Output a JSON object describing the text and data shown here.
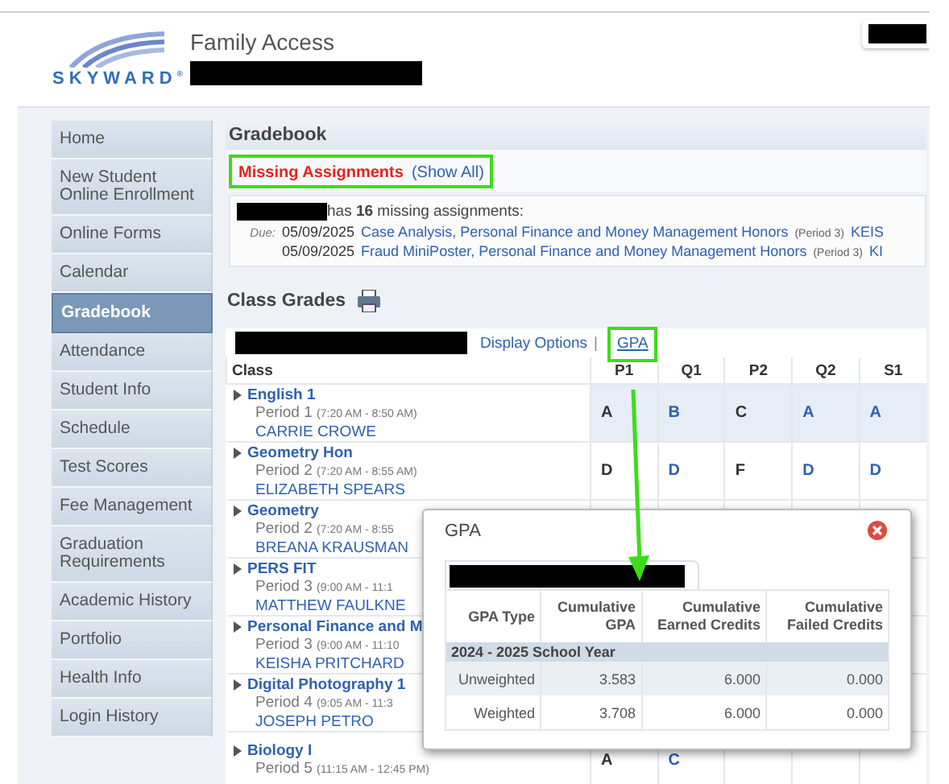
{
  "header": {
    "logo_text": "SKYWARD$^{®}$",
    "app_title": "Family Access"
  },
  "sidebar": {
    "items": [
      {
        "label": "Home",
        "selected": false
      },
      {
        "label": "New Student Online Enrollment",
        "selected": false
      },
      {
        "label": "Online Forms",
        "selected": false
      },
      {
        "label": "Calendar",
        "selected": false
      },
      {
        "label": "Gradebook",
        "selected": true
      },
      {
        "label": "Attendance",
        "selected": false
      },
      {
        "label": "Student Info",
        "selected": false
      },
      {
        "label": "Schedule",
        "selected": false
      },
      {
        "label": "Test Scores",
        "selected": false
      },
      {
        "label": "Fee Management",
        "selected": false
      },
      {
        "label": "Graduation Requirements",
        "selected": false
      },
      {
        "label": "Academic History",
        "selected": false
      },
      {
        "label": "Portfolio",
        "selected": false
      },
      {
        "label": "Health Info",
        "selected": false
      },
      {
        "label": "Login History",
        "selected": false
      }
    ]
  },
  "gradebook": {
    "title": "Gradebook",
    "missing": {
      "heading": "Missing Assignments",
      "show_all": "(Show All)",
      "summary": "has **16** missing assignments:",
      "due_label": "Due:",
      "assignments": [
        {
          "date": "05/09/2025",
          "title": "Case Analysis, Personal Finance and Money Management Honors",
          "period": "(Period 3)",
          "teacher": "KEIS"
        },
        {
          "date": "05/09/2025",
          "title": "Fraud MiniPoster, Personal Finance and Money Management Honors",
          "period": "(Period 3)",
          "teacher": "KI"
        }
      ]
    }
  },
  "class_grades": {
    "title": "Class Grades",
    "display_options": "Display Options",
    "separator": "|",
    "gpa_link": "GPA",
    "columns": [
      {
        "label": "Class",
        "kind": "class"
      },
      {
        "label": "P1",
        "kind": "progress"
      },
      {
        "label": "Q1",
        "kind": "term"
      },
      {
        "label": "P2",
        "kind": "progress"
      },
      {
        "label": "Q2",
        "kind": "term"
      },
      {
        "label": "S1",
        "kind": "term"
      }
    ],
    "rows": [
      {
        "class": "English 1",
        "period": "Period 1",
        "time": "(7:20 AM - 8:50 AM)",
        "teacher": "CARRIE CROWE",
        "highlighted": true,
        "grades": [
          "A",
          "B",
          "C",
          "A",
          "A"
        ]
      },
      {
        "class": "Geometry Hon",
        "period": "Period 2",
        "time": "(7:20 AM - 8:55 AM)",
        "teacher": "ELIZABETH SPEARS",
        "highlighted": false,
        "grades": [
          "D",
          "D",
          "F",
          "D",
          "D"
        ]
      },
      {
        "class": "Geometry",
        "period": "Period 2",
        "time": "(7:20 AM - 8:55",
        "teacher": "BREANA KRAUSMAN",
        "highlighted": false
      },
      {
        "class": "PERS FIT",
        "period": "Period 3",
        "time": "(9:00 AM - 11:1",
        "teacher": "MATTHEW FAULKNE",
        "highlighted": false
      },
      {
        "class": "Personal Finance and M",
        "period": "Period 3",
        "time": "(9:00 AM - 11:10",
        "teacher": "KEISHA PRITCHARD",
        "highlighted": false
      },
      {
        "class": "Digital Photography 1",
        "period": "Period 4",
        "time": "(9:05 AM - 11:3",
        "teacher": "JOSEPH PETRO",
        "highlighted": false
      },
      {
        "class": "Biology I",
        "period": "Period 5",
        "time": "(11:15 AM - 12:45 PM)",
        "highlighted": false,
        "grades": [
          "A",
          "C"
        ]
      }
    ]
  },
  "gpa_dialog": {
    "title": "GPA",
    "columns": [
      "GPA Type",
      "Cumulative GPA",
      "Cumulative Earned Credits",
      "Cumulative Failed Credits"
    ],
    "group": "2024 - 2025 School Year",
    "rows": [
      {
        "type": "Unweighted",
        "gpa": "3.583",
        "earned": "6.000",
        "failed": "0.000",
        "shaded": true
      },
      {
        "type": "Weighted",
        "gpa": "3.708",
        "earned": "6.000",
        "failed": "0.000",
        "shaded": false
      }
    ]
  }
}
